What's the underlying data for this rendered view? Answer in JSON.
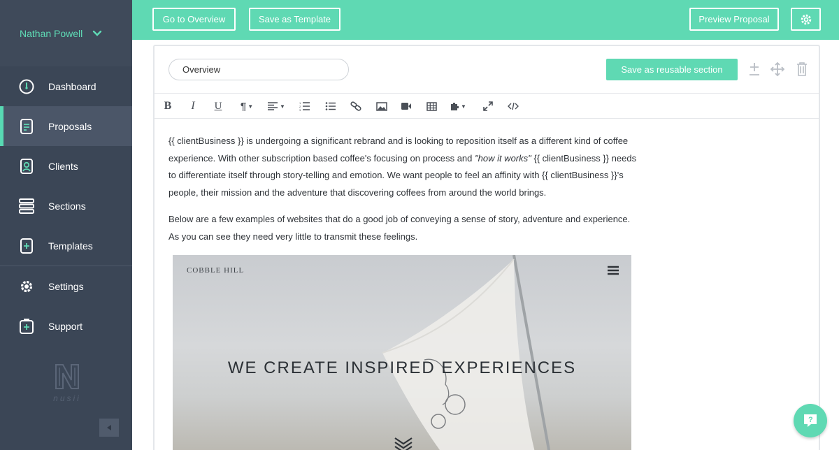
{
  "sidebar": {
    "user_name": "Nathan Powell",
    "items": [
      {
        "label": "Dashboard",
        "icon": "dashboard-icon"
      },
      {
        "label": "Proposals",
        "icon": "proposals-icon",
        "active": true
      },
      {
        "label": "Clients",
        "icon": "clients-icon"
      },
      {
        "label": "Sections",
        "icon": "sections-icon"
      },
      {
        "label": "Templates",
        "icon": "templates-icon"
      },
      {
        "label": "Settings",
        "icon": "settings-icon"
      },
      {
        "label": "Support",
        "icon": "support-icon"
      }
    ],
    "logo_text": "nusii"
  },
  "topbar": {
    "go_overview": "Go to Overview",
    "save_template": "Save as Template",
    "preview": "Preview Proposal"
  },
  "editor": {
    "section_title": "Overview",
    "reuse_label": "Save as reusable section",
    "toolbar_icons": [
      "bold-icon",
      "italic-icon",
      "underline-icon",
      "paragraph-icon",
      "align-icon",
      "ordered-list-icon",
      "unordered-list-icon",
      "link-icon",
      "image-icon",
      "video-icon",
      "table-icon",
      "plugin-icon",
      "fullscreen-icon",
      "code-icon"
    ],
    "paragraph1_a": "{{ clientBusiness }} is undergoing a significant rebrand and is looking to reposition itself as a different kind of coffee experience. With other subscription based coffee's focusing on process and ",
    "paragraph1_em": "\"how it works\"",
    "paragraph1_b": " {{ clientBusiness }} needs to differentiate itself through story-telling and emotion. We want people to feel an affinity with {{ clientBusiness }}'s people, their mission and the adventure that discovering coffees from around the world brings.",
    "paragraph2": "Below are a few examples of websites that do a good job of conveying a sense of story, adventure and experience. As you can see they need very little to transmit these feelings.",
    "hero": {
      "brand": "COBBLE HILL",
      "headline": "WE CREATE INSPIRED EXPERIENCES"
    }
  },
  "colors": {
    "accent": "#5fd9b3",
    "sidebar_bg": "#3b4656"
  }
}
